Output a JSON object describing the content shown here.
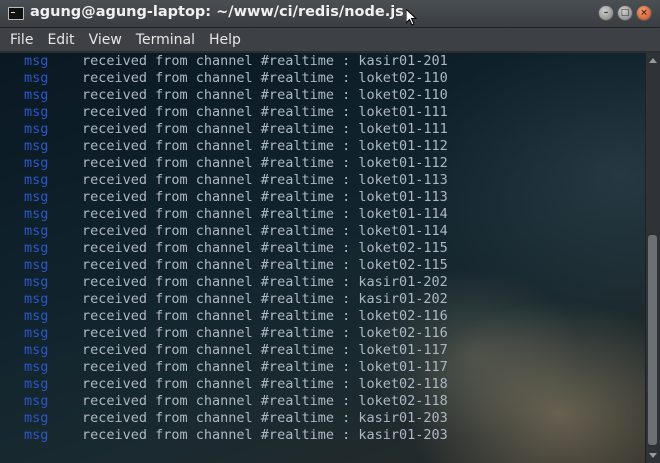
{
  "window": {
    "title": "agung@agung-laptop: ~/www/ci/redis/node.js"
  },
  "menubar": {
    "items": [
      "File",
      "Edit",
      "View",
      "Terminal",
      "Help"
    ]
  },
  "terminal": {
    "lines": [
      {
        "tag": "msg",
        "text": "received from channel #realtime : kasir01-201"
      },
      {
        "tag": "msg",
        "text": "received from channel #realtime : loket02-110"
      },
      {
        "tag": "msg",
        "text": "received from channel #realtime : loket02-110"
      },
      {
        "tag": "msg",
        "text": "received from channel #realtime : loket01-111"
      },
      {
        "tag": "msg",
        "text": "received from channel #realtime : loket01-111"
      },
      {
        "tag": "msg",
        "text": "received from channel #realtime : loket01-112"
      },
      {
        "tag": "msg",
        "text": "received from channel #realtime : loket01-112"
      },
      {
        "tag": "msg",
        "text": "received from channel #realtime : loket01-113"
      },
      {
        "tag": "msg",
        "text": "received from channel #realtime : loket01-113"
      },
      {
        "tag": "msg",
        "text": "received from channel #realtime : loket01-114"
      },
      {
        "tag": "msg",
        "text": "received from channel #realtime : loket01-114"
      },
      {
        "tag": "msg",
        "text": "received from channel #realtime : loket02-115"
      },
      {
        "tag": "msg",
        "text": "received from channel #realtime : loket02-115"
      },
      {
        "tag": "msg",
        "text": "received from channel #realtime : kasir01-202"
      },
      {
        "tag": "msg",
        "text": "received from channel #realtime : kasir01-202"
      },
      {
        "tag": "msg",
        "text": "received from channel #realtime : loket02-116"
      },
      {
        "tag": "msg",
        "text": "received from channel #realtime : loket02-116"
      },
      {
        "tag": "msg",
        "text": "received from channel #realtime : loket01-117"
      },
      {
        "tag": "msg",
        "text": "received from channel #realtime : loket01-117"
      },
      {
        "tag": "msg",
        "text": "received from channel #realtime : loket02-118"
      },
      {
        "tag": "msg",
        "text": "received from channel #realtime : loket02-118"
      },
      {
        "tag": "msg",
        "text": "received from channel #realtime : kasir01-203"
      },
      {
        "tag": "msg",
        "text": "received from channel #realtime : kasir01-203"
      }
    ]
  },
  "colors": {
    "tag": "#2d57c8",
    "text": "#aeb8c4"
  }
}
